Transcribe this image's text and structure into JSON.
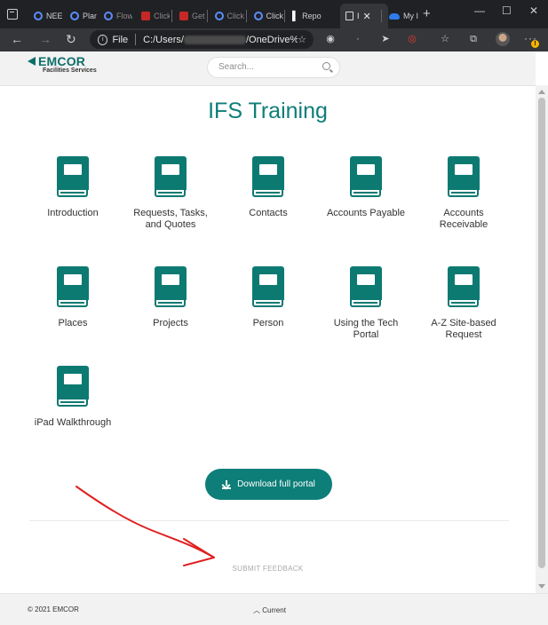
{
  "browser": {
    "tabs": [
      {
        "label": "NEEI",
        "favicon": "blue-circle-icon",
        "dim": false
      },
      {
        "label": "Plan",
        "favicon": "blue-circle-icon",
        "dim": false
      },
      {
        "label": "Flow",
        "favicon": "blue-circle-icon",
        "dim": true
      },
      {
        "label": "Click",
        "favicon": "red-square-icon",
        "dim": true
      },
      {
        "label": "Get",
        "favicon": "red-square-icon",
        "dim": true
      },
      {
        "label": "Click",
        "favicon": "blue-circle-icon",
        "dim": true
      },
      {
        "label": "Click",
        "favicon": "blue-circle-icon",
        "dim": false
      },
      {
        "label": "Repo",
        "favicon": "bi-icon",
        "dim": false
      },
      {
        "label": "I",
        "favicon": "document-icon",
        "dim": false,
        "active": true
      },
      {
        "label": "My I",
        "favicon": "onedrive-icon",
        "dim": false
      }
    ],
    "close_glyph": "✕",
    "new_tab_glyph": "+",
    "address": {
      "scheme_label": "File",
      "url_prefix": "C:/Users/",
      "url_suffix": "/OneDrive%..."
    }
  },
  "site": {
    "logo_name": "EMCOR",
    "logo_subtitle": "Facilities Services",
    "search_placeholder": "Search...",
    "title": "IFS Training",
    "modules": [
      {
        "label": "Introduction"
      },
      {
        "label": "Requests, Tasks, and Quotes"
      },
      {
        "label": "Contacts"
      },
      {
        "label": "Accounts Payable"
      },
      {
        "label": "Accounts Receivable"
      },
      {
        "label": "Places"
      },
      {
        "label": "Projects"
      },
      {
        "label": "Person"
      },
      {
        "label": "Using the Tech Portal"
      },
      {
        "label": "A-Z Site-based Request"
      },
      {
        "label": "iPad Walkthrough"
      }
    ],
    "download_label": "Download full portal",
    "feedback_label": "SUBMIT FEEDBACK",
    "footer": {
      "copyright": "© 2021 EMCOR",
      "current_label": "Current"
    }
  },
  "colors": {
    "brand_teal": "#0d7e78",
    "annotation_red": "#e02020"
  }
}
